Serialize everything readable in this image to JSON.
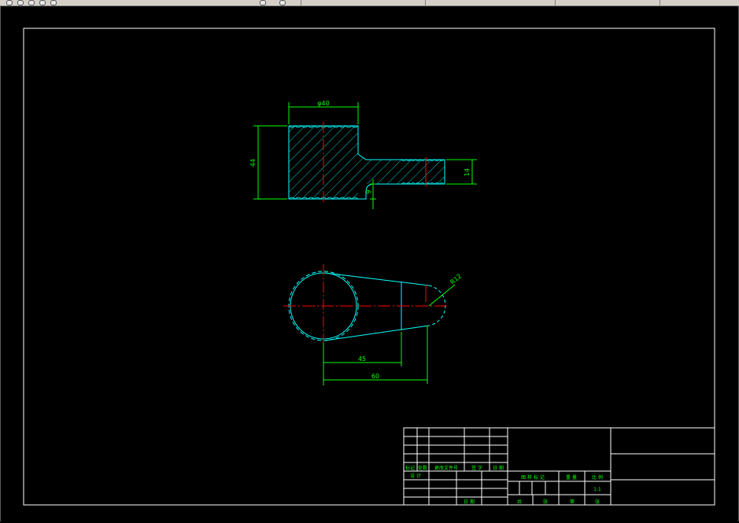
{
  "drawing": {
    "front_view": {
      "dimensions": {
        "diameter": "φ40",
        "height": "44",
        "boss": "14",
        "step": "9"
      }
    },
    "top_view": {
      "dimensions": {
        "radius": "R12",
        "offset_45": "45",
        "offset_60": "60"
      }
    },
    "title_block": {
      "row_labels": [
        "标记",
        "处数",
        "更改文件号",
        "签 字",
        "日 期"
      ],
      "designer_label": "设 计",
      "date_label": "日 期",
      "header_labels": [
        "图 样 标 记",
        "重 量",
        "比 例"
      ],
      "scale_value": "1:1",
      "sheet_labels": [
        "共",
        "张",
        "第",
        "张"
      ]
    }
  },
  "colors": {
    "outline": "#00ffff",
    "dimension": "#00ff00",
    "centerline": "#ff0000",
    "frame": "#ffffff"
  }
}
